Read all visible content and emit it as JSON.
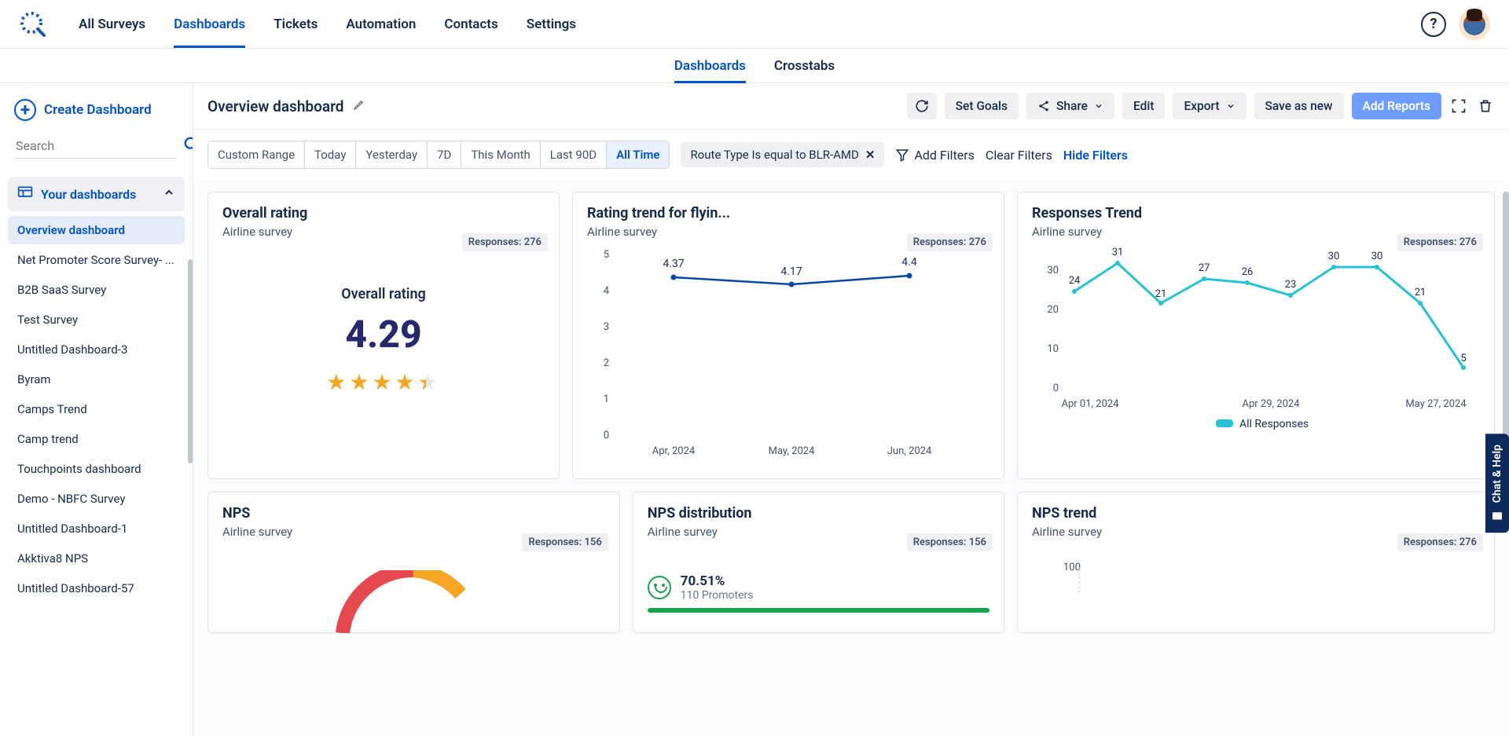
{
  "nav": {
    "items": [
      "All Surveys",
      "Dashboards",
      "Tickets",
      "Automation",
      "Contacts",
      "Settings"
    ],
    "active": "Dashboards"
  },
  "subtabs": {
    "items": [
      "Dashboards",
      "Crosstabs"
    ],
    "active": "Dashboards"
  },
  "sidebar": {
    "create": "Create Dashboard",
    "search_placeholder": "Search",
    "section": "Your dashboards",
    "items": [
      "Overview dashboard",
      "Net Promoter Score Survey- ...",
      "B2B SaaS Survey",
      "Test Survey",
      "Untitled Dashboard-3",
      "Byram",
      "Camps Trend",
      "Camp trend",
      "Touchpoints dashboard",
      "Demo - NBFC Survey",
      "Untitled Dashboard-1",
      "Akktiva8 NPS",
      "Untitled Dashboard-57"
    ],
    "active": "Overview dashboard"
  },
  "titlebar": {
    "title": "Overview dashboard",
    "buttons": {
      "set_goals": "Set Goals",
      "share": "Share",
      "edit": "Edit",
      "export": "Export",
      "save_as_new": "Save as new",
      "add_reports": "Add Reports"
    }
  },
  "filters": {
    "time_chips": [
      "Custom Range",
      "Today",
      "Yesterday",
      "7D",
      "This Month",
      "Last 90D",
      "All Time"
    ],
    "time_active": "All Time",
    "pill_text": "Route Type Is equal to BLR-AMD",
    "add": "Add Filters",
    "clear": "Clear Filters",
    "hide": "Hide Filters"
  },
  "widgets": {
    "overall": {
      "title": "Overall rating",
      "survey": "Airline survey",
      "responses": "Responses: 276",
      "heading": "Overall rating",
      "value": "4.29",
      "stars": 4.3
    },
    "rating_trend": {
      "title": "Rating trend for flyin...",
      "survey": "Airline survey",
      "responses": "Responses: 276"
    },
    "responses_trend": {
      "title": "Responses Trend",
      "survey": "Airline survey",
      "responses": "Responses: 276",
      "legend": "All Responses"
    },
    "nps": {
      "title": "NPS",
      "survey": "Airline survey",
      "responses": "Responses: 156"
    },
    "nps_dist": {
      "title": "NPS distribution",
      "survey": "Airline survey",
      "responses": "Responses: 156",
      "percent": "70.51%",
      "sub": "110 Promoters"
    },
    "nps_trend": {
      "title": "NPS trend",
      "survey": "Airline survey",
      "responses": "Responses: 276"
    }
  },
  "chat_help": "Chat & Help",
  "chart_data": [
    {
      "id": "rating_trend",
      "type": "line",
      "categories": [
        "Apr, 2024",
        "May, 2024",
        "Jun, 2024"
      ],
      "values": [
        4.37,
        4.17,
        4.4
      ],
      "ylim": [
        0,
        5
      ],
      "yticks": [
        0,
        1,
        2,
        3,
        4,
        5
      ]
    },
    {
      "id": "responses_trend",
      "type": "line",
      "x_ticks": [
        "Apr 01, 2024",
        "Apr 29, 2024",
        "May 27, 2024"
      ],
      "values": [
        24,
        31,
        21,
        27,
        26,
        23,
        30,
        30,
        21,
        5
      ],
      "ylim": [
        0,
        35
      ],
      "yticks": [
        0,
        10,
        20,
        30
      ],
      "series_name": "All Responses"
    },
    {
      "id": "nps_trend",
      "type": "line",
      "yticks": [
        100
      ]
    }
  ]
}
